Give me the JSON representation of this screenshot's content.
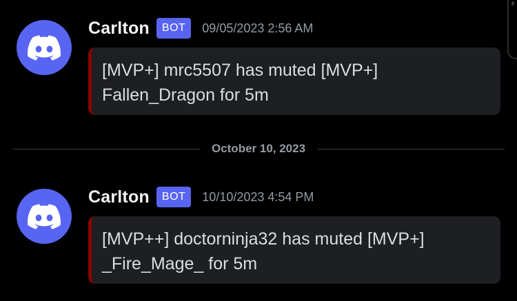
{
  "divider": {
    "date": "October 10, 2023"
  },
  "messages": [
    {
      "username": "Carlton",
      "tag": "BOT",
      "timestamp": "09/05/2023 2:56 AM",
      "embed_line1": "[MVP+] mrc5507 has muted [MVP+]",
      "embed_line2": "Fallen_Dragon for 5m",
      "avatar_icon": "discord-logo-icon"
    },
    {
      "username": "Carlton",
      "tag": "BOT",
      "timestamp": "10/10/2023 4:54 PM",
      "embed_line1": "[MVP++] doctorninja32 has muted [MVP+]",
      "embed_line2": "_Fire_Mage_ for 5m",
      "avatar_icon": "discord-logo-icon"
    }
  ],
  "colors": {
    "background": "#000000",
    "avatar": "#5865f2",
    "bot_tag": "#5865f2",
    "embed_bg": "#1e1f22",
    "embed_accent": "#8b0000",
    "username": "#f2f3f5",
    "timestamp": "#949ba4"
  }
}
